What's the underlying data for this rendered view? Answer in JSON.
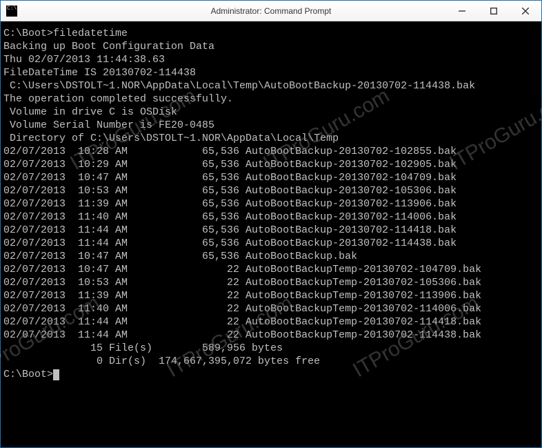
{
  "window": {
    "title": "Administrator: Command Prompt"
  },
  "terminal": {
    "prompt1": "C:\\Boot>filedatetime",
    "lines_pre": [
      "Backing up Boot Configuration Data",
      "Thu 02/07/2013 11:44:38.63",
      "FileDateTime IS 20130702-114438",
      " C:\\Users\\DSTOLT~1.NOR\\AppData\\Local\\Temp\\AutoBootBackup-20130702-114438.bak",
      "The operation completed successfully.",
      " Volume in drive C is OSDisk",
      " Volume Serial Number is FE20-0485",
      "",
      " Directory of C:\\Users\\DSTOLT~1.NOR\\AppData\\Local\\Temp",
      ""
    ],
    "files": [
      {
        "date": "02/07/2013",
        "time": "10:28 AM",
        "size": "65,536",
        "name": "AutoBootBackup-20130702-102855.bak"
      },
      {
        "date": "02/07/2013",
        "time": "10:29 AM",
        "size": "65,536",
        "name": "AutoBootBackup-20130702-102905.bak"
      },
      {
        "date": "02/07/2013",
        "time": "10:47 AM",
        "size": "65,536",
        "name": "AutoBootBackup-20130702-104709.bak"
      },
      {
        "date": "02/07/2013",
        "time": "10:53 AM",
        "size": "65,536",
        "name": "AutoBootBackup-20130702-105306.bak"
      },
      {
        "date": "02/07/2013",
        "time": "11:39 AM",
        "size": "65,536",
        "name": "AutoBootBackup-20130702-113906.bak"
      },
      {
        "date": "02/07/2013",
        "time": "11:40 AM",
        "size": "65,536",
        "name": "AutoBootBackup-20130702-114006.bak"
      },
      {
        "date": "02/07/2013",
        "time": "11:44 AM",
        "size": "65,536",
        "name": "AutoBootBackup-20130702-114418.bak"
      },
      {
        "date": "02/07/2013",
        "time": "11:44 AM",
        "size": "65,536",
        "name": "AutoBootBackup-20130702-114438.bak"
      },
      {
        "date": "02/07/2013",
        "time": "10:47 AM",
        "size": "65,536",
        "name": "AutoBootBackup.bak"
      },
      {
        "date": "02/07/2013",
        "time": "10:47 AM",
        "size": "22",
        "name": "AutoBootBackupTemp-20130702-104709.bak"
      },
      {
        "date": "02/07/2013",
        "time": "10:53 AM",
        "size": "22",
        "name": "AutoBootBackupTemp-20130702-105306.bak"
      },
      {
        "date": "02/07/2013",
        "time": "11:39 AM",
        "size": "22",
        "name": "AutoBootBackupTemp-20130702-113906.bak"
      },
      {
        "date": "02/07/2013",
        "time": "11:40 AM",
        "size": "22",
        "name": "AutoBootBackupTemp-20130702-114006.bak"
      },
      {
        "date": "02/07/2013",
        "time": "11:44 AM",
        "size": "22",
        "name": "AutoBootBackupTemp-20130702-114418.bak"
      },
      {
        "date": "02/07/2013",
        "time": "11:44 AM",
        "size": "22",
        "name": "AutoBootBackupTemp-20130702-114438.bak"
      }
    ],
    "summary": [
      "              15 File(s)        589,956 bytes",
      "               0 Dir(s)  174,667,395,072 bytes free"
    ],
    "prompt_end": "C:\\Boot>"
  },
  "watermark": "ITProGuru.com"
}
